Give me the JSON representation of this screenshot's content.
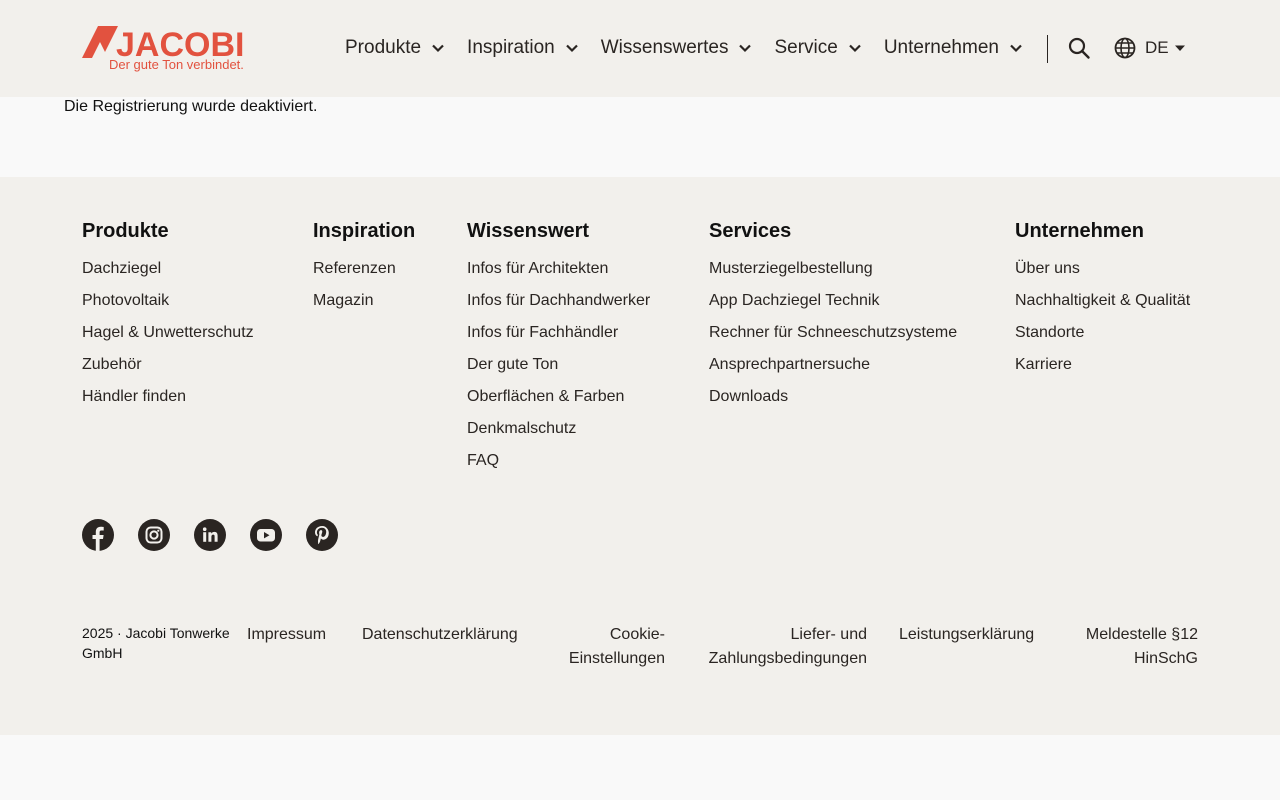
{
  "colors": {
    "brand": "#e2523f",
    "header_bg": "#f2f0ec",
    "text": "#2a2522"
  },
  "header": {
    "logo_text": "JACOBI",
    "logo_tagline": "Der gute Ton verbindet.",
    "nav": [
      {
        "label": "Produkte"
      },
      {
        "label": "Inspiration"
      },
      {
        "label": "Wissenswertes"
      },
      {
        "label": "Service"
      },
      {
        "label": "Unternehmen"
      }
    ],
    "language": "DE"
  },
  "main": {
    "message": "Die Registrierung wurde deaktiviert."
  },
  "footer": {
    "columns": [
      {
        "title": "Produkte",
        "links": [
          "Dachziegel",
          "Photovoltaik",
          "Hagel & Unwetterschutz",
          "Zubehör",
          "Händler finden"
        ]
      },
      {
        "title": "Inspiration",
        "links": [
          "Referenzen",
          "Magazin"
        ]
      },
      {
        "title": "Wissenswert",
        "links": [
          "Infos für Architekten",
          "Infos für Dachhandwerker",
          "Infos für Fachhändler",
          "Der gute Ton",
          "Oberflächen & Farben",
          "Denkmalschutz",
          "FAQ"
        ]
      },
      {
        "title": "Services",
        "links": [
          "Musterziegelbestellung",
          "App Dachziegel Technik",
          "Rechner für Schneeschutzsysteme",
          "Ansprechpartnersuche",
          "Downloads"
        ]
      },
      {
        "title": "Unternehmen",
        "links": [
          "Über uns",
          "Nachhaltigkeit & Qualität",
          "Standorte",
          "Karriere"
        ]
      }
    ],
    "social": [
      "facebook-icon",
      "instagram-icon",
      "linkedin-icon",
      "youtube-icon",
      "pinterest-icon"
    ],
    "copyright_line1": "2025 · Jacobi Tonwerke",
    "copyright_line2": "GmbH",
    "legal": {
      "impressum": "Impressum",
      "datenschutz": "Datenschutzerklärung",
      "cookie_line1": "Cookie-",
      "cookie_line2": "Einstellungen",
      "liefer_line1": "Liefer- und",
      "liefer_line2": "Zahlungsbedingungen",
      "leistung": "Leistungserklärung",
      "melde_line1": "Meldestelle §12",
      "melde_line2": "HinSchG"
    }
  }
}
